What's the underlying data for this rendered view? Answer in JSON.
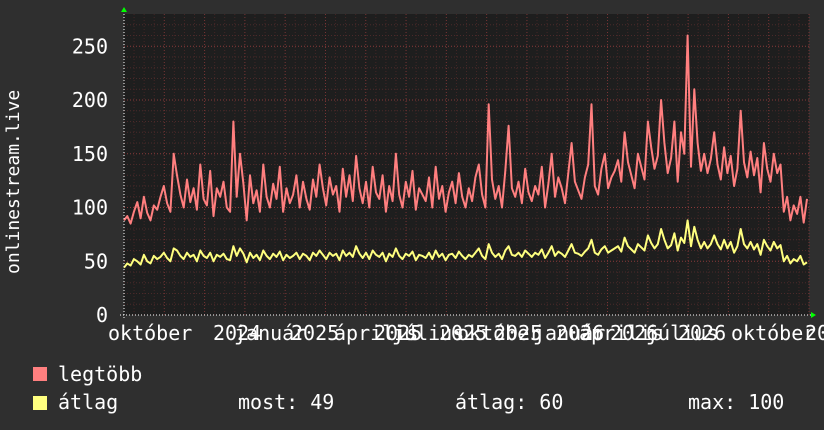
{
  "chart_data": {
    "type": "line",
    "ylabel": "onlinestream.live",
    "ylim": [
      0,
      280
    ],
    "yticks": [
      0,
      50,
      100,
      150,
      200,
      250
    ],
    "xtick_labels": [
      "október",
      "2024",
      "január",
      "2025",
      "április",
      "2025",
      "július",
      "2025",
      "október",
      "2025",
      "január",
      "2026",
      "április",
      "2026",
      "július",
      "2026",
      "október",
      "20"
    ],
    "grid": true,
    "legend": "bottom-left",
    "colors": {
      "background": "#2f2f2f",
      "canvas": "#1e1e1e",
      "grid": "#6b3030",
      "max_series": "#ff7f7f",
      "avg_series": "#ffff7f"
    },
    "series": [
      {
        "name": "legtöbb",
        "color": "#ff7f7f",
        "values": [
          88,
          92,
          85,
          96,
          105,
          90,
          110,
          95,
          88,
          102,
          98,
          110,
          120,
          104,
          96,
          150,
          130,
          112,
          100,
          126,
          105,
          118,
          98,
          140,
          108,
          102,
          134,
          92,
          118,
          110,
          124,
          100,
          96,
          180,
          110,
          150,
          122,
          88,
          130,
          104,
          116,
          96,
          140,
          110,
          100,
          122,
          108,
          138,
          96,
          118,
          104,
          112,
          130,
          100,
          124,
          108,
          98,
          126,
          110,
          140,
          118,
          102,
          128,
          112,
          120,
          96,
          136,
          110,
          130,
          106,
          148,
          118,
          104,
          124,
          100,
          138,
          114,
          108,
          130,
          96,
          120,
          106,
          150,
          112,
          100,
          124,
          110,
          134,
          98,
          118,
          112,
          106,
          128,
          100,
          138,
          108,
          120,
          96,
          114,
          124,
          104,
          132,
          110,
          100,
          118,
          106,
          128,
          140,
          112,
          100,
          196,
          126,
          108,
          120,
          100,
          134,
          176,
          118,
          110,
          124,
          104,
          136,
          114,
          106,
          120,
          112,
          138,
          100,
          122,
          150,
          110,
          128,
          118,
          104,
          132,
          160,
          124,
          116,
          108,
          128,
          140,
          196,
          120,
          112,
          136,
          150,
          118,
          128,
          134,
          144,
          124,
          170,
          142,
          130,
          118,
          150,
          138,
          126,
          180,
          156,
          136,
          148,
          200,
          160,
          132,
          146,
          180,
          124,
          170,
          150,
          260,
          138,
          210,
          160,
          134,
          150,
          132,
          145,
          170,
          140,
          126,
          156,
          132,
          148,
          120,
          136,
          190,
          142,
          128,
          152,
          130,
          146,
          114,
          160,
          136,
          124,
          150,
          132,
          140,
          96,
          110,
          88,
          102,
          94,
          110,
          86,
          108
        ]
      },
      {
        "name": "átlag",
        "color": "#ffff7f",
        "values": [
          44,
          48,
          46,
          52,
          50,
          47,
          56,
          50,
          48,
          55,
          52,
          54,
          58,
          53,
          50,
          62,
          60,
          55,
          52,
          58,
          54,
          56,
          50,
          60,
          55,
          53,
          58,
          50,
          56,
          54,
          57,
          52,
          51,
          64,
          55,
          62,
          57,
          49,
          58,
          53,
          56,
          51,
          60,
          55,
          52,
          57,
          54,
          59,
          51,
          56,
          53,
          55,
          58,
          52,
          57,
          55,
          51,
          58,
          55,
          60,
          56,
          52,
          58,
          55,
          57,
          51,
          60,
          55,
          58,
          54,
          64,
          57,
          53,
          58,
          52,
          60,
          56,
          54,
          58,
          50,
          57,
          54,
          62,
          55,
          52,
          57,
          55,
          59,
          51,
          56,
          55,
          53,
          58,
          52,
          60,
          54,
          57,
          51,
          56,
          57,
          53,
          59,
          55,
          52,
          56,
          54,
          58,
          62,
          55,
          52,
          66,
          58,
          54,
          57,
          52,
          60,
          64,
          56,
          55,
          58,
          54,
          60,
          57,
          54,
          58,
          56,
          61,
          53,
          58,
          64,
          55,
          59,
          57,
          54,
          60,
          66,
          58,
          57,
          55,
          59,
          62,
          70,
          58,
          56,
          61,
          64,
          58,
          60,
          62,
          64,
          59,
          72,
          64,
          61,
          58,
          66,
          63,
          60,
          74,
          67,
          62,
          66,
          80,
          70,
          62,
          65,
          76,
          60,
          72,
          67,
          88,
          64,
          82,
          70,
          62,
          68,
          62,
          66,
          74,
          66,
          61,
          70,
          62,
          68,
          58,
          64,
          80,
          66,
          62,
          68,
          61,
          66,
          56,
          70,
          64,
          60,
          68,
          62,
          65,
          50,
          55,
          48,
          52,
          50,
          55,
          47,
          49
        ]
      }
    ]
  },
  "legend": {
    "items": [
      {
        "label": "legtöbb",
        "color": "#ff7f7f"
      },
      {
        "label": "átlag",
        "color": "#ffff7f"
      }
    ],
    "stats": {
      "now": "most: 49",
      "avg": "átlag: 60",
      "max": "max: 100"
    }
  }
}
